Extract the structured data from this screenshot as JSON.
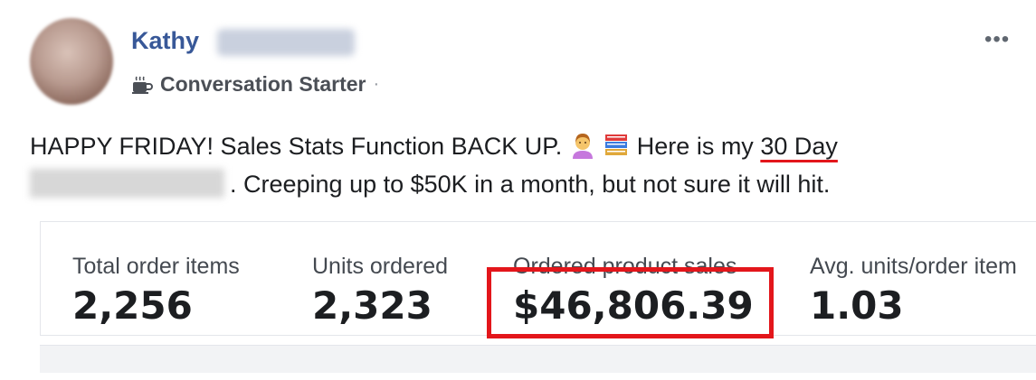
{
  "post": {
    "author_first_name": "Kathy",
    "badge_label": "Conversation Starter",
    "badge_separator": "·",
    "more_label": "•••",
    "text_part1": "HAPPY FRIDAY! Sales Stats Function BACK UP.",
    "text_part2": "Here is my",
    "text_underlined": "30 Day",
    "text_part3": ". Creeping up to $50K in a month, but not sure it will hit."
  },
  "stats": [
    {
      "label": "Total order items",
      "value": "2,256"
    },
    {
      "label": "Units ordered",
      "value": "2,323"
    },
    {
      "label": "Ordered product sales",
      "value": "$46,806.39"
    },
    {
      "label": "Avg. units/order item",
      "value": "1.03"
    }
  ],
  "colors": {
    "author_link": "#385898",
    "highlight": "#e3161b"
  },
  "icons": {
    "badge": "coffee-cup-icon",
    "more": "more-options-icon",
    "emoji1": "person-raising-hand-emoji",
    "emoji2": "books-emoji"
  }
}
